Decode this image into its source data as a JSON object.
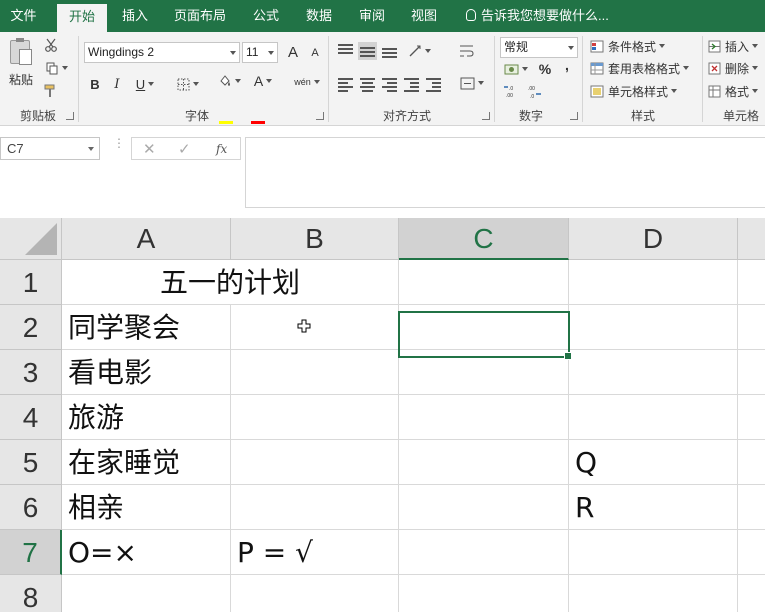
{
  "tabs": [
    {
      "label": "文件",
      "active": false
    },
    {
      "label": "开始",
      "active": true
    },
    {
      "label": "插入",
      "active": false
    },
    {
      "label": "页面布局",
      "active": false
    },
    {
      "label": "公式",
      "active": false
    },
    {
      "label": "数据",
      "active": false
    },
    {
      "label": "审阅",
      "active": false
    },
    {
      "label": "视图",
      "active": false
    }
  ],
  "tell_me": "告诉我您想要做什么...",
  "ribbon": {
    "clipboard": {
      "label": "剪贴板",
      "paste": "粘贴"
    },
    "font": {
      "label": "字体",
      "font_name": "Wingdings 2",
      "font_size": "11",
      "bold": "B",
      "italic": "I",
      "underline": "U",
      "grow": "A",
      "shrink": "A",
      "phonetic": "wén"
    },
    "alignment": {
      "label": "对齐方式"
    },
    "number": {
      "label": "数字",
      "format": "常规",
      "percent": "%",
      "comma": ","
    },
    "styles": {
      "label": "样式",
      "conditional": "条件格式",
      "table": "套用表格格式",
      "cell_styles": "单元格样式"
    },
    "cells": {
      "label": "单元格",
      "insert": "插入",
      "delete": "删除",
      "format": "格式"
    }
  },
  "formula_bar": {
    "name_box": "C7",
    "cancel": "✕",
    "enter": "✓",
    "fx": "fx",
    "content": ""
  },
  "columns": [
    "A",
    "B",
    "C",
    "D"
  ],
  "rows": [
    "1",
    "2",
    "3",
    "4",
    "5",
    "6",
    "7",
    "8"
  ],
  "cells": {
    "A1": "五一的计划",
    "A2": "同学聚会",
    "A3": "看电影",
    "A4": "旅游",
    "A5": "在家睡觉",
    "A6": "相亲",
    "A7": "O=×",
    "B7": "P = √",
    "D5": "Q",
    "D6": "R"
  },
  "selected_cell": "C7",
  "colors": {
    "accent": "#217346",
    "header_bg": "#e6e6e6",
    "selected_header_bg": "#d2d2d2"
  }
}
